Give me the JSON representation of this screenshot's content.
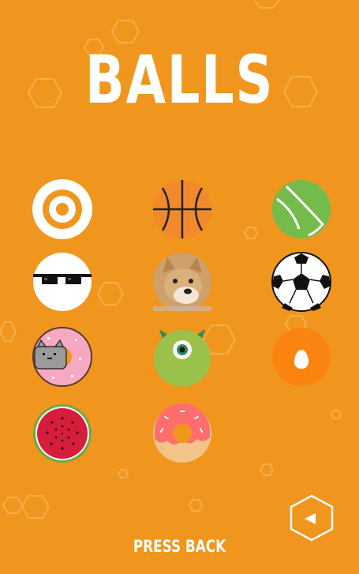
{
  "screen": {
    "title": "BALLS",
    "footer_text": "PRESS BACK"
  },
  "colors": {
    "background": "#f0961e",
    "text": "#ffffff"
  },
  "balls": [
    {
      "name": "target-ball",
      "icon": "target-icon"
    },
    {
      "name": "basketball-ball",
      "icon": "basketball-icon"
    },
    {
      "name": "tennis-ball",
      "icon": "tennis-ball-icon"
    },
    {
      "name": "sunglasses-ball",
      "icon": "sunglasses-icon"
    },
    {
      "name": "doge-ball",
      "icon": "doge-icon"
    },
    {
      "name": "soccer-ball",
      "icon": "soccer-ball-icon"
    },
    {
      "name": "pusheen-donut-ball",
      "icon": "pusheen-cat-icon"
    },
    {
      "name": "monster-ball",
      "icon": "one-eyed-monster-icon"
    },
    {
      "name": "egg-ball",
      "icon": "egg-icon"
    },
    {
      "name": "watermelon-ball",
      "icon": "watermelon-icon"
    },
    {
      "name": "donut-ball",
      "icon": "donut-icon"
    }
  ],
  "back_button": {
    "icon": "triangle-left-icon"
  }
}
